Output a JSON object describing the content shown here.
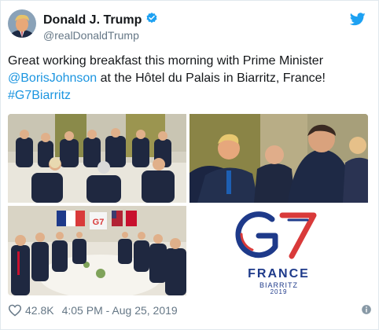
{
  "user": {
    "display_name": "Donald J. Trump",
    "handle": "@realDonaldTrump",
    "verified": true
  },
  "tweet": {
    "text_before": "Great working breakfast this morning with Prime Minister ",
    "mention": "@BorisJohnson",
    "text_after": " at the Hôtel du Palais in Biarritz, France!",
    "hashtag": "#G7Biarritz"
  },
  "media": {
    "g7_logo": {
      "line1": "G7",
      "line2": "FRANCE",
      "line3": "BIARRITZ",
      "line4": "2019"
    }
  },
  "footer": {
    "likes": "42.8K",
    "timestamp": "4:05 PM - Aug 25, 2019"
  },
  "colors": {
    "link": "#1b95e0",
    "verified": "#1da1f2",
    "twitter_blue": "#1da1f2",
    "g7_blue": "#1e3a8a",
    "g7_red": "#d93a3a"
  },
  "icons": [
    "verified-badge-icon",
    "twitter-bird-icon",
    "heart-icon",
    "info-icon"
  ]
}
